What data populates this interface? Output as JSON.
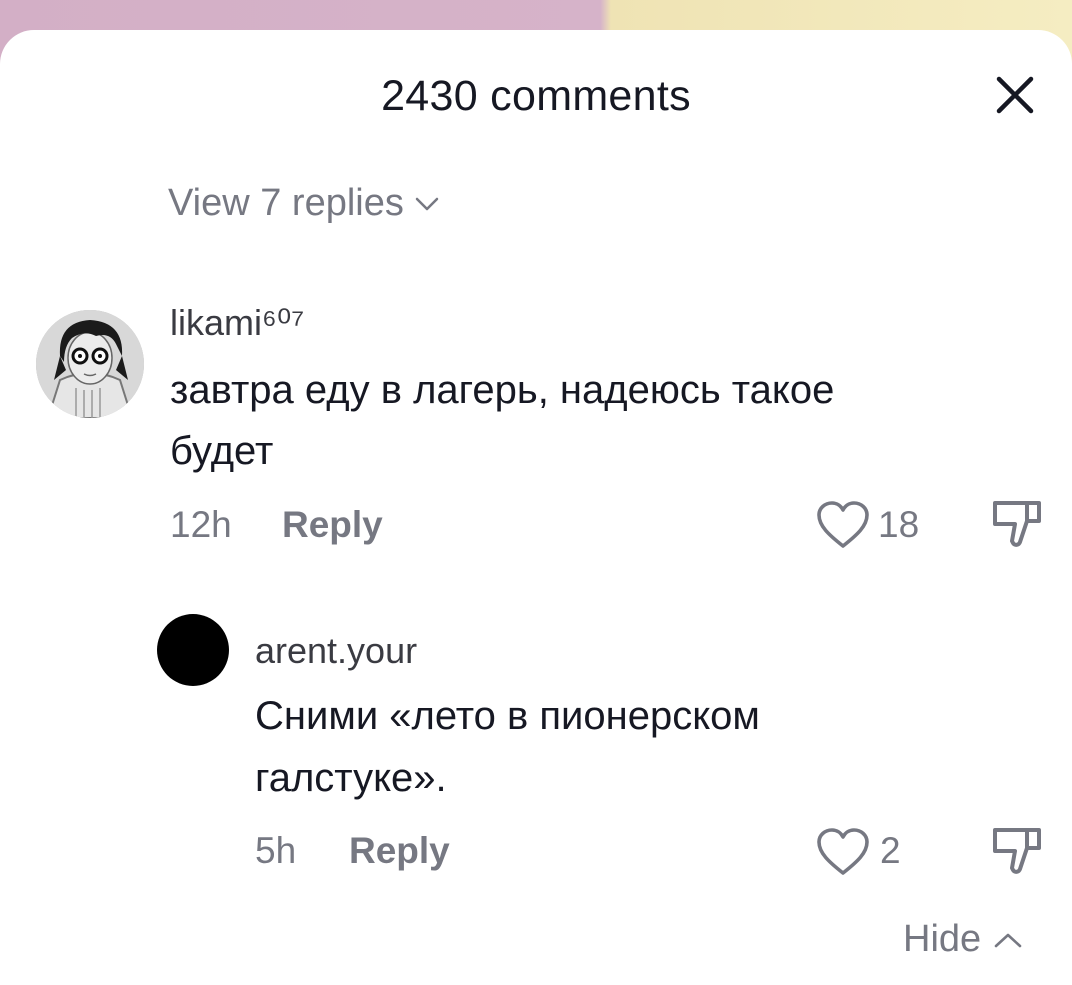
{
  "header": {
    "title": "2430 comments",
    "close_icon": "close-icon"
  },
  "thread": {
    "view_replies_label": "View 7 replies"
  },
  "comments": [
    {
      "username": "likami⁶⁰⁷",
      "text_line1": "завтра еду в лагерь, надеюсь такое",
      "text_line2": "будет",
      "time": "12h",
      "reply_label": "Reply",
      "likes": "18"
    },
    {
      "username": "arent.your",
      "text_line1": "Сними «лето в пионерском",
      "text_line2": "галстуке».",
      "time": "5h",
      "reply_label": "Reply",
      "likes": "2"
    }
  ],
  "footer": {
    "hide_label": "Hide"
  },
  "colors": {
    "primary_text": "#161823",
    "secondary_text": "#767882",
    "background": "#ffffff"
  }
}
